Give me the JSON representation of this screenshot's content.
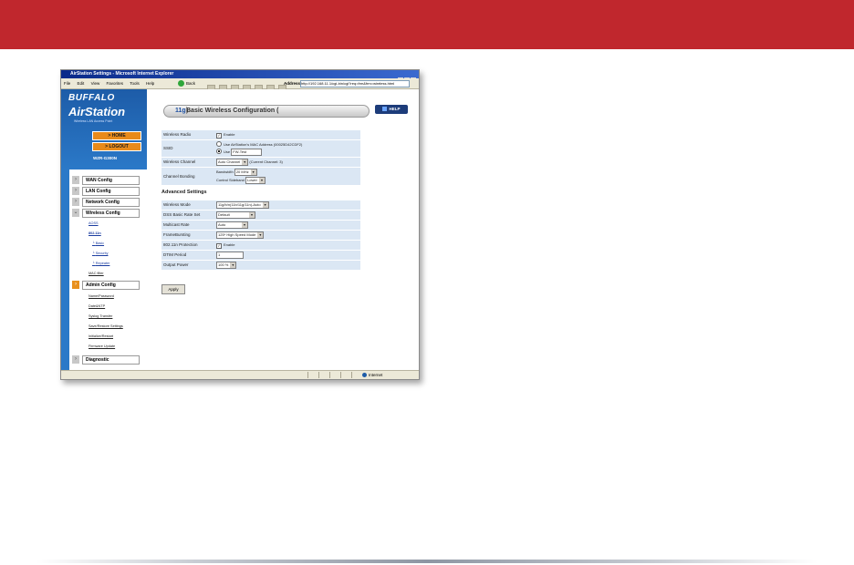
{
  "colors": {
    "banner": "#c0272d",
    "brand_blue": "#1d5ca8",
    "nav_orange": "#e88a1a",
    "form_row": "#dbe7f4"
  },
  "browser": {
    "title": "AirStation Settings - Microsoft Internet Explorer",
    "menu": [
      "File",
      "Edit",
      "View",
      "Favorites",
      "Tools",
      "Help"
    ],
    "back_label": "Back",
    "address_label": "Address",
    "address_value": "http://192.168.11.1/cgi-bin/cgi?req=frm&frm=wireless.html",
    "status_zone": "Internet"
  },
  "sidebar": {
    "brand": "BUFFALO",
    "product": "AirStation",
    "tagline": "Wireless LAN Access Point",
    "home": "HOME",
    "logout": "LOGOUT",
    "model": "WZR-G300N",
    "menu": [
      {
        "label": "WAN Config",
        "icon": "chevron-right-icon"
      },
      {
        "label": "LAN Config",
        "icon": "chevron-right-icon"
      },
      {
        "label": "Network Config",
        "icon": "chevron-right-icon"
      },
      {
        "label": "Wireless Config",
        "icon": "chevron-down-icon"
      }
    ],
    "wireless_sub": [
      "AOSS",
      "802.11n",
      "Basic",
      "Security",
      "Repeater",
      "MAC filter"
    ],
    "admin": {
      "label": "Admin Config",
      "icon": "chevron-down-icon"
    },
    "admin_sub": [
      "Name/Password",
      "Date&NTP",
      "Syslog Transfer",
      "Save/Restore Settings",
      "Initialize/Restart",
      "Firmware Update"
    ],
    "diagnostic": {
      "label": "Diagnostic",
      "icon": "chevron-right-icon"
    }
  },
  "main": {
    "title_prefix": "Basic Wireless Configuration (",
    "title_mode": "11g",
    "title_suffix": ")",
    "help": "HELP",
    "rows": {
      "radio_label": "Wireless Radio",
      "radio_enable": "Enable",
      "ssid_label": "SSID",
      "ssid_opt1": "Use AirStation's MAC Address (00025D42CDF2)",
      "ssid_opt2": "Use",
      "ssid_value": "FW-Test",
      "channel_label": "Wireless Channel",
      "channel_value": "Auto Channel",
      "channel_current": "(Current Channel: 3)",
      "bonding_label": "Channel Bonding",
      "bandwidth_label": "Bandwidth",
      "bandwidth_value": "20 MHz",
      "control_label": "Control Sideband",
      "control_value": "Lower"
    },
    "advanced_heading": "Advanced Settings",
    "advanced": {
      "mode_label": "Wireless Mode",
      "mode_value": "11g/b/n(11b/11g/11n)-Auto",
      "rate_label": "DSS Basic Rate Set",
      "rate_value": "Default",
      "mrate_label": "Multicast Rate",
      "mrate_value": "Auto",
      "burst_label": "FrameBursting",
      "burst_value": "125* High Speed Mode",
      "prot_label": "802.11n Protection",
      "prot_enable": "Enable",
      "dtim_label": "DTIM Period",
      "dtim_value": "1",
      "power_label": "Output Power",
      "power_value": "100 %"
    },
    "apply": "Apply"
  }
}
